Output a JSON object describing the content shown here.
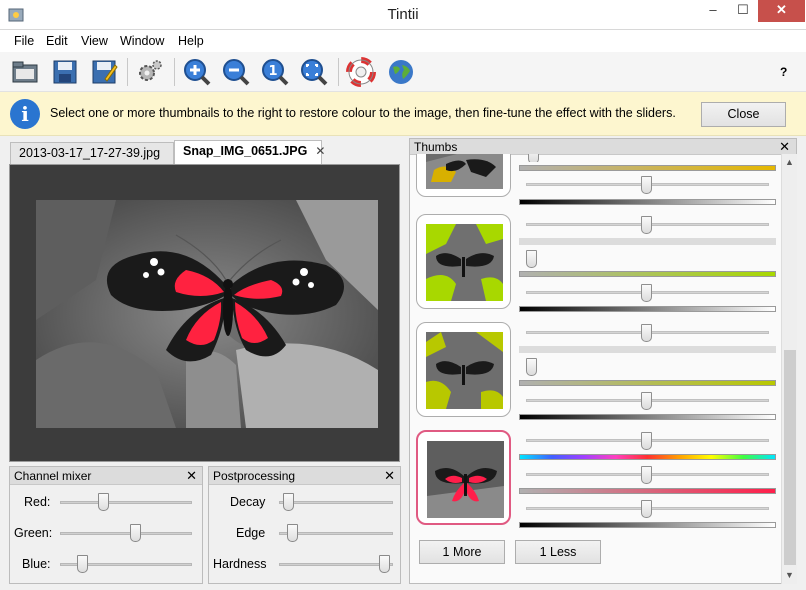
{
  "window": {
    "title": "Tintii",
    "min": "–",
    "max": "☐",
    "close": "✕"
  },
  "menu": [
    "File",
    "Edit",
    "View",
    "Window",
    "Help"
  ],
  "toolbar": {
    "help_label": "?"
  },
  "info": {
    "icon": "i",
    "message": "Select one or more thumbnails to the right to restore colour to the image, then fine-tune the effect with the sliders.",
    "close_label": "Close"
  },
  "tabs": [
    {
      "label": "2013-03-17_17-27-39.jpg",
      "active": false
    },
    {
      "label": "Snap_IMG_0651.JPG",
      "active": true,
      "close": "✕"
    }
  ],
  "channel_mixer": {
    "title": "Channel mixer",
    "close": "✕",
    "sliders": [
      {
        "label": "Red:",
        "value": 0.31
      },
      {
        "label": "Green:",
        "value": 0.58
      },
      {
        "label": "Blue:",
        "value": 0.14
      }
    ]
  },
  "postprocessing": {
    "title": "Postprocessing",
    "close": "✕",
    "sliders": [
      {
        "label": "Decay",
        "value": 0.04
      },
      {
        "label": "Edge",
        "value": 0.08
      },
      {
        "label": "Hardness",
        "value": 0.97
      }
    ]
  },
  "thumbs": {
    "title": "Thumbs",
    "close": "✕",
    "items": [
      {
        "name": "yellow",
        "color": "#e6b800",
        "selected": false
      },
      {
        "name": "green",
        "color": "#a8d800",
        "selected": false
      },
      {
        "name": "yellow-green",
        "color": "#b8c800",
        "selected": false
      },
      {
        "name": "red",
        "color": "#ff1e4a",
        "selected": true
      }
    ],
    "more_label": "1 More",
    "less_label": "1 Less"
  },
  "colors": {
    "accent_close": "#c7504b",
    "info_bg": "#fdf6cf",
    "selected_border": "#e05a82"
  }
}
